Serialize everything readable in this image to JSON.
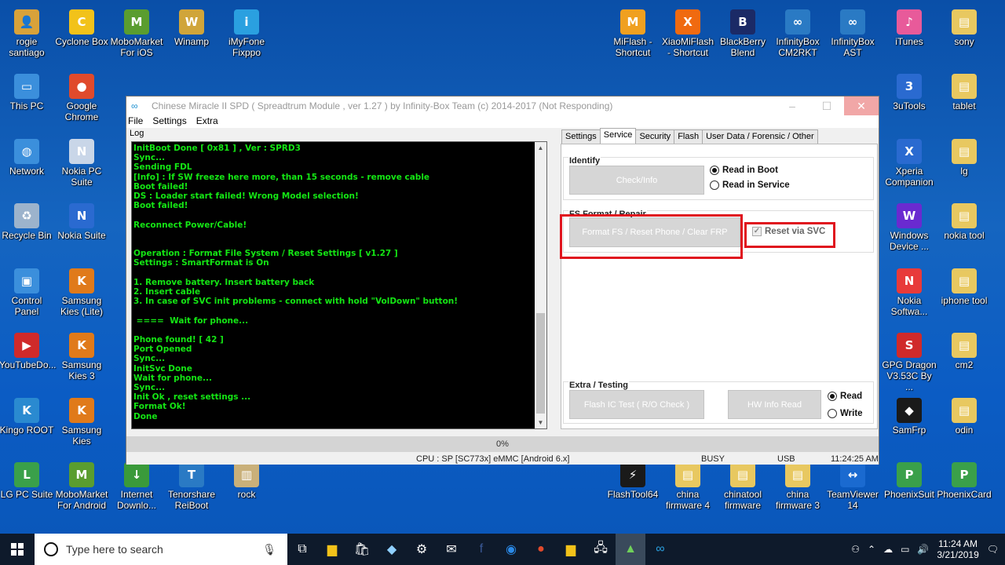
{
  "desktop_icons": [
    {
      "label": "rogie santiago",
      "color": "#d8a23a",
      "glyph": "👤"
    },
    {
      "label": "Cyclone Box",
      "color": "#f2c21a",
      "glyph": "C"
    },
    {
      "label": "MoboMarket For iOS",
      "color": "#5a9d2f",
      "glyph": "M"
    },
    {
      "label": "Winamp",
      "color": "#d0a53a",
      "glyph": "W"
    },
    {
      "label": "iMyFone Fixppo",
      "color": "#2aa0e0",
      "glyph": "i"
    },
    {
      "label": "MiFlash - Shortcut",
      "color": "#f0a020",
      "glyph": "M"
    },
    {
      "label": "XiaoMiFlash - Shortcut",
      "color": "#f06a10",
      "glyph": "X"
    },
    {
      "label": "BlackBerry Blend",
      "color": "#1b2a66",
      "glyph": "B"
    },
    {
      "label": "InfinityBox CM2RKT",
      "color": "#2a7ac4",
      "glyph": "∞"
    },
    {
      "label": "InfinityBox AST",
      "color": "#2a7ac4",
      "glyph": "∞"
    },
    {
      "label": "iTunes",
      "color": "#e85a9a",
      "glyph": "♪"
    },
    {
      "label": "sony",
      "color": "#e8c860",
      "glyph": "▤"
    },
    {
      "label": "This PC",
      "color": "#3b8fdc",
      "glyph": "▭"
    },
    {
      "label": "Google Chrome",
      "color": "#e04a2c",
      "glyph": "●"
    },
    {
      "label": "3uTools",
      "color": "#2a6ad0",
      "glyph": "3"
    },
    {
      "label": "tablet",
      "color": "#e8c860",
      "glyph": "▤"
    },
    {
      "label": "Network",
      "color": "#3b8fdc",
      "glyph": "◍"
    },
    {
      "label": "Nokia PC Suite",
      "color": "#c9d6e8",
      "glyph": "N"
    },
    {
      "label": "Xperia Companion",
      "color": "#2a6ad0",
      "glyph": "X"
    },
    {
      "label": "lg",
      "color": "#e8c860",
      "glyph": "▤"
    },
    {
      "label": "Recycle Bin",
      "color": "#9cb3cc",
      "glyph": "♻"
    },
    {
      "label": "Nokia Suite",
      "color": "#2a6ad0",
      "glyph": "N"
    },
    {
      "label": "Windows Device ...",
      "color": "#6a2ad0",
      "glyph": "W"
    },
    {
      "label": "nokia tool",
      "color": "#e8c860",
      "glyph": "▤"
    },
    {
      "label": "Control Panel",
      "color": "#3b8fdc",
      "glyph": "▣"
    },
    {
      "label": "Samsung Kies (Lite)",
      "color": "#e07a1a",
      "glyph": "K"
    },
    {
      "label": "Nokia Softwa...",
      "color": "#e83a3a",
      "glyph": "N"
    },
    {
      "label": "iphone tool",
      "color": "#e8c860",
      "glyph": "▤"
    },
    {
      "label": "YouTubeDo...",
      "color": "#d02a2a",
      "glyph": "▶"
    },
    {
      "label": "Samsung Kies 3",
      "color": "#e07a1a",
      "glyph": "K"
    },
    {
      "label": "GPG Dragon V3.53C By ...",
      "color": "#d02a2a",
      "glyph": "S"
    },
    {
      "label": "cm2",
      "color": "#e8c860",
      "glyph": "▤"
    },
    {
      "label": "Kingo ROOT",
      "color": "#2a8ad0",
      "glyph": "K"
    },
    {
      "label": "Samsung Kies",
      "color": "#e07a1a",
      "glyph": "K"
    },
    {
      "label": "SamFrp",
      "color": "#1a1a1a",
      "glyph": "◆"
    },
    {
      "label": "odin",
      "color": "#e8c860",
      "glyph": "▤"
    },
    {
      "label": "LG PC Suite",
      "color": "#3aa04a",
      "glyph": "L"
    },
    {
      "label": "MoboMarket For Android",
      "color": "#5a9d2f",
      "glyph": "M"
    },
    {
      "label": "Internet Downlo...",
      "color": "#3a9a3a",
      "glyph": "↓"
    },
    {
      "label": "Tenorshare ReiBoot",
      "color": "#2a7ac4",
      "glyph": "T"
    },
    {
      "label": "rock",
      "color": "#c9b07a",
      "glyph": "▥"
    },
    {
      "label": "FlashTool64",
      "color": "#1a1a1a",
      "glyph": "⚡"
    },
    {
      "label": "china firmware 4",
      "color": "#e8c860",
      "glyph": "▤"
    },
    {
      "label": "chinatool firmware",
      "color": "#e8c860",
      "glyph": "▤"
    },
    {
      "label": "china firmware 3",
      "color": "#e8c860",
      "glyph": "▤"
    },
    {
      "label": "TeamViewer 14",
      "color": "#1a6ad0",
      "glyph": "↔"
    },
    {
      "label": "PhoenixSuit",
      "color": "#3aa04a",
      "glyph": "P"
    },
    {
      "label": "PhoenixCard",
      "color": "#3aa04a",
      "glyph": "P"
    }
  ],
  "window": {
    "title": "Chinese Miracle II SPD ( Spreadtrum Module , ver 1.27 ) by Infinity-Box Team (c) 2014-2017 (Not Responding)",
    "menu": [
      "File",
      "Settings",
      "Extra"
    ],
    "log_label": "Log",
    "log_lines": [
      "InitBoot Done [ 0x81 ] , Ver : SPRD3",
      "Sync...",
      "Sending FDL",
      "[Info] : If SW freeze here more, than 15 seconds - remove cable",
      "Boot failed!",
      "DS : Loader start failed! Wrong Model selection!",
      "Boot failed!",
      "",
      "Reconnect Power/Cable!",
      "",
      "",
      "Operation : Format File System / Reset Settings [ v1.27 ]",
      "Settings : SmartFormat is On",
      "",
      "1. Remove battery. Insert battery back",
      "2. Insert cable",
      "3. In case of SVC init problems - connect with hold \"VolDown\" button!",
      "",
      ", ====  Wait for phone...",
      "",
      "Phone found! [ 42 ]",
      "Port Opened",
      "Sync...",
      "InitSvc Done",
      "Wait for phone...",
      "Sync...",
      "Init Ok , reset settings ...",
      "Format Ok!",
      "Done"
    ],
    "tabs": [
      "Settings",
      "Service",
      "Security",
      "Flash",
      "User Data / Forensic / Other"
    ],
    "active_tab": "Service",
    "identify": {
      "title": "Identify",
      "button": "Check/Info",
      "options": [
        "Read in Boot",
        "Read in Service"
      ],
      "selected": "Read in Boot"
    },
    "fs_format": {
      "title": "FS Format / Repair",
      "button": "Format FS / Reset Phone / Clear FRP",
      "checkbox_label": "Reset via SVC",
      "checked": true
    },
    "extra": {
      "title": "Extra / Testing",
      "button1": "Flash IC Test ( R/O Check )",
      "button2": "HW Info Read",
      "options": [
        "Read",
        "Write"
      ],
      "selected": "Read"
    },
    "progress": "0%",
    "status": {
      "cpu": "CPU : SP [SC773x] eMMC [Android 6.x]",
      "busy": "BUSY",
      "usb": "USB",
      "time": "11:24:25 AM"
    }
  },
  "taskbar": {
    "search_placeholder": "Type here to search",
    "time": "11:24 AM",
    "date": "3/21/2019"
  }
}
